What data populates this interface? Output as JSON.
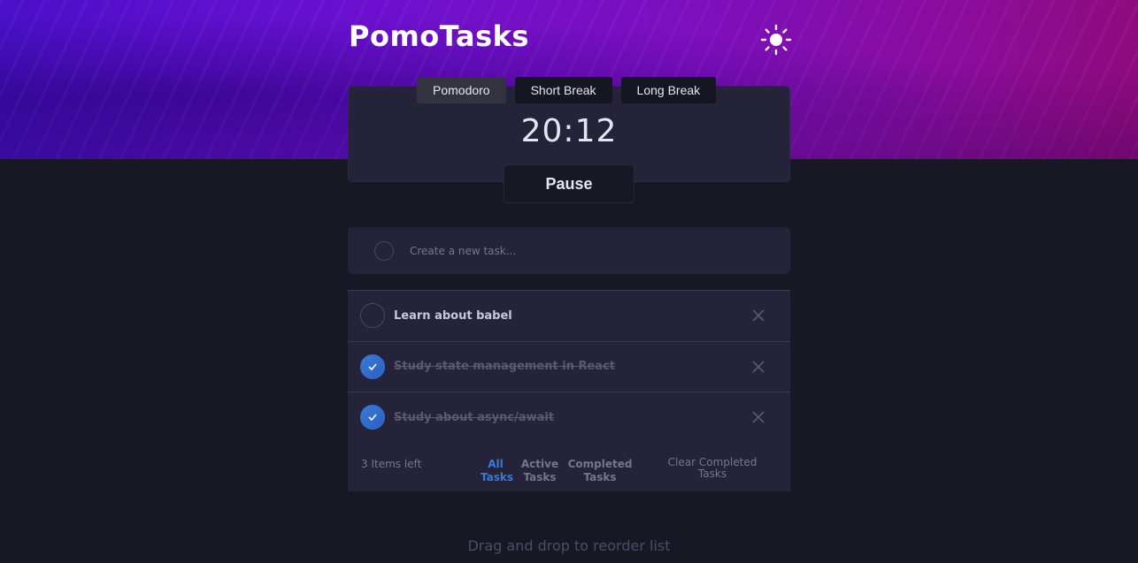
{
  "header": {
    "app_title": "PomoTasks",
    "theme_icon": "sun-icon"
  },
  "timer": {
    "modes": [
      {
        "label": "Pomodoro",
        "active": true
      },
      {
        "label": "Short Break",
        "active": false
      },
      {
        "label": "Long Break",
        "active": false
      }
    ],
    "time": "20:12",
    "pause_label": "Pause"
  },
  "new_task": {
    "placeholder": "Create a new task..."
  },
  "tasks": [
    {
      "text": "Learn about babel",
      "completed": false
    },
    {
      "text": "Study state management in React",
      "completed": true
    },
    {
      "text": "Study about async/await",
      "completed": true
    }
  ],
  "footer": {
    "items_left": "3 Items left",
    "filters": {
      "all": "All Tasks",
      "active": "Active Tasks",
      "completed": "Completed Tasks"
    },
    "clear_completed": "Clear Completed Tasks"
  },
  "hint": "Drag and drop to reorder list",
  "colors": {
    "accent": "#3a7bd5",
    "background": "#181824",
    "card": "#25233a"
  }
}
